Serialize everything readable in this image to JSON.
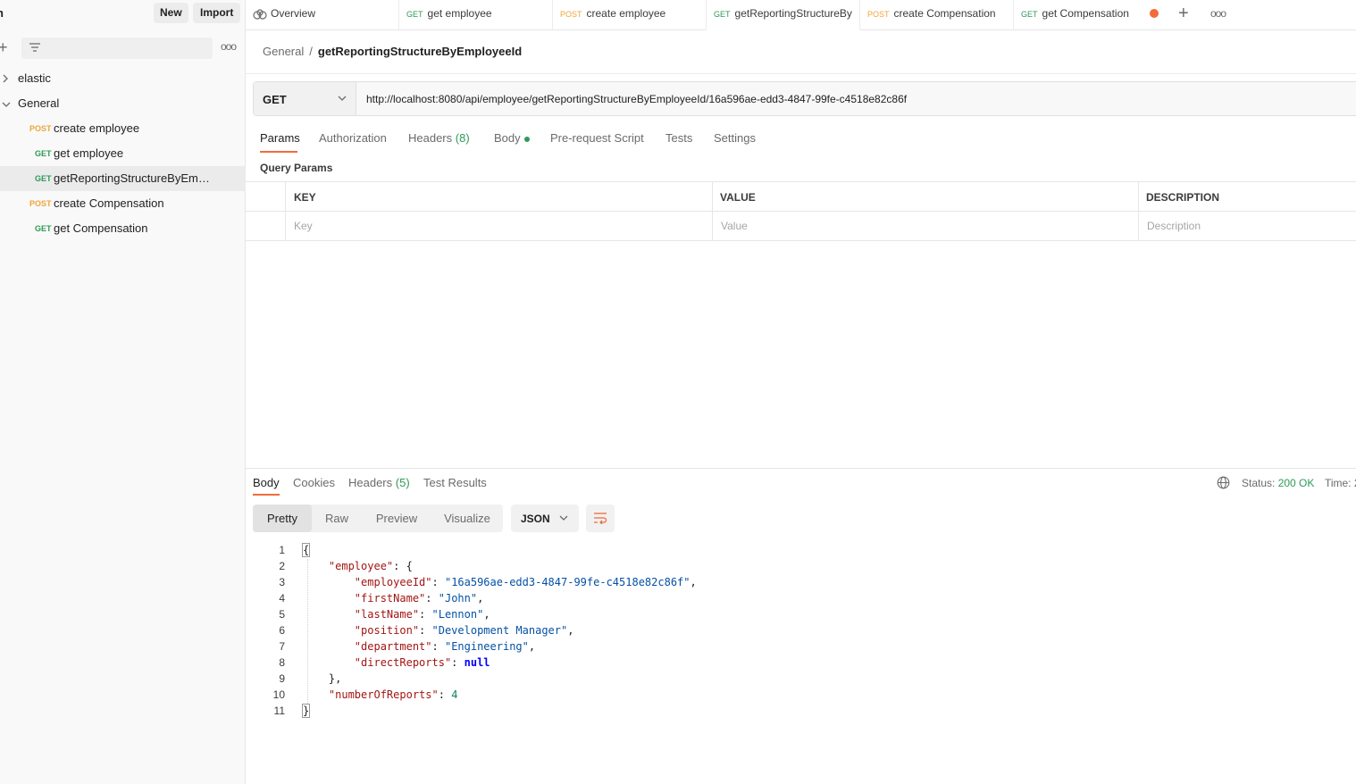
{
  "sidebar": {
    "workspace_name": "h",
    "new_label": "New",
    "import_label": "Import",
    "tree": [
      {
        "type": "folder",
        "label": "elastic",
        "expanded": false
      },
      {
        "type": "folder",
        "label": "General",
        "expanded": true
      },
      {
        "type": "request",
        "method": "POST",
        "label": "create employee"
      },
      {
        "type": "request",
        "method": "GET",
        "label": "get employee"
      },
      {
        "type": "request",
        "method": "GET",
        "label": "getReportingStructureByEmpl...",
        "active": true
      },
      {
        "type": "request",
        "method": "POST",
        "label": "create Compensation"
      },
      {
        "type": "request",
        "method": "GET",
        "label": "get Compensation"
      }
    ]
  },
  "tabs": [
    {
      "method": "",
      "label": "Overview"
    },
    {
      "method": "GET",
      "label": "get employee"
    },
    {
      "method": "POST",
      "label": "create employee"
    },
    {
      "method": "GET",
      "label": "getReportingStructureBy",
      "active": true
    },
    {
      "method": "POST",
      "label": "create Compensation"
    },
    {
      "method": "GET",
      "label": "get Compensation"
    }
  ],
  "breadcrumb": {
    "parent": "General",
    "separator": "/",
    "current": "getReportingStructureByEmployeeId"
  },
  "request": {
    "method": "GET",
    "url": "http://localhost:8080/api/employee/getReportingStructureByEmployeeId/16a596ae-edd3-4847-99fe-c4518e82c86f"
  },
  "request_tabs": {
    "params": "Params",
    "authorization": "Authorization",
    "headers": "Headers",
    "headers_count": "(8)",
    "body": "Body",
    "prerequest": "Pre-request Script",
    "tests": "Tests",
    "settings": "Settings"
  },
  "query_params": {
    "title": "Query Params",
    "columns": [
      "KEY",
      "VALUE",
      "DESCRIPTION"
    ],
    "placeholders": [
      "Key",
      "Value",
      "Description"
    ]
  },
  "response": {
    "tabs": {
      "body": "Body",
      "cookies": "Cookies",
      "headers": "Headers",
      "headers_count": "(5)",
      "tests": "Test Results"
    },
    "status_label": "Status:",
    "status_value": "200 OK",
    "time_label": "Time: 2",
    "views": [
      "Pretty",
      "Raw",
      "Preview",
      "Visualize"
    ],
    "format": "JSON",
    "lines": [
      "1",
      "2",
      "3",
      "4",
      "5",
      "6",
      "7",
      "8",
      "9",
      "10",
      "11"
    ],
    "json": {
      "employeeId": "16a596ae-edd3-4847-99fe-c4518e82c86f",
      "firstName": "John",
      "lastName": "Lennon",
      "position": "Development Manager",
      "department": "Engineering",
      "directReports": "null",
      "numberOfReports": "4"
    }
  },
  "colors": {
    "accent": "#f26b3a",
    "get": "#2e9a58",
    "post": "#f0a53a"
  }
}
